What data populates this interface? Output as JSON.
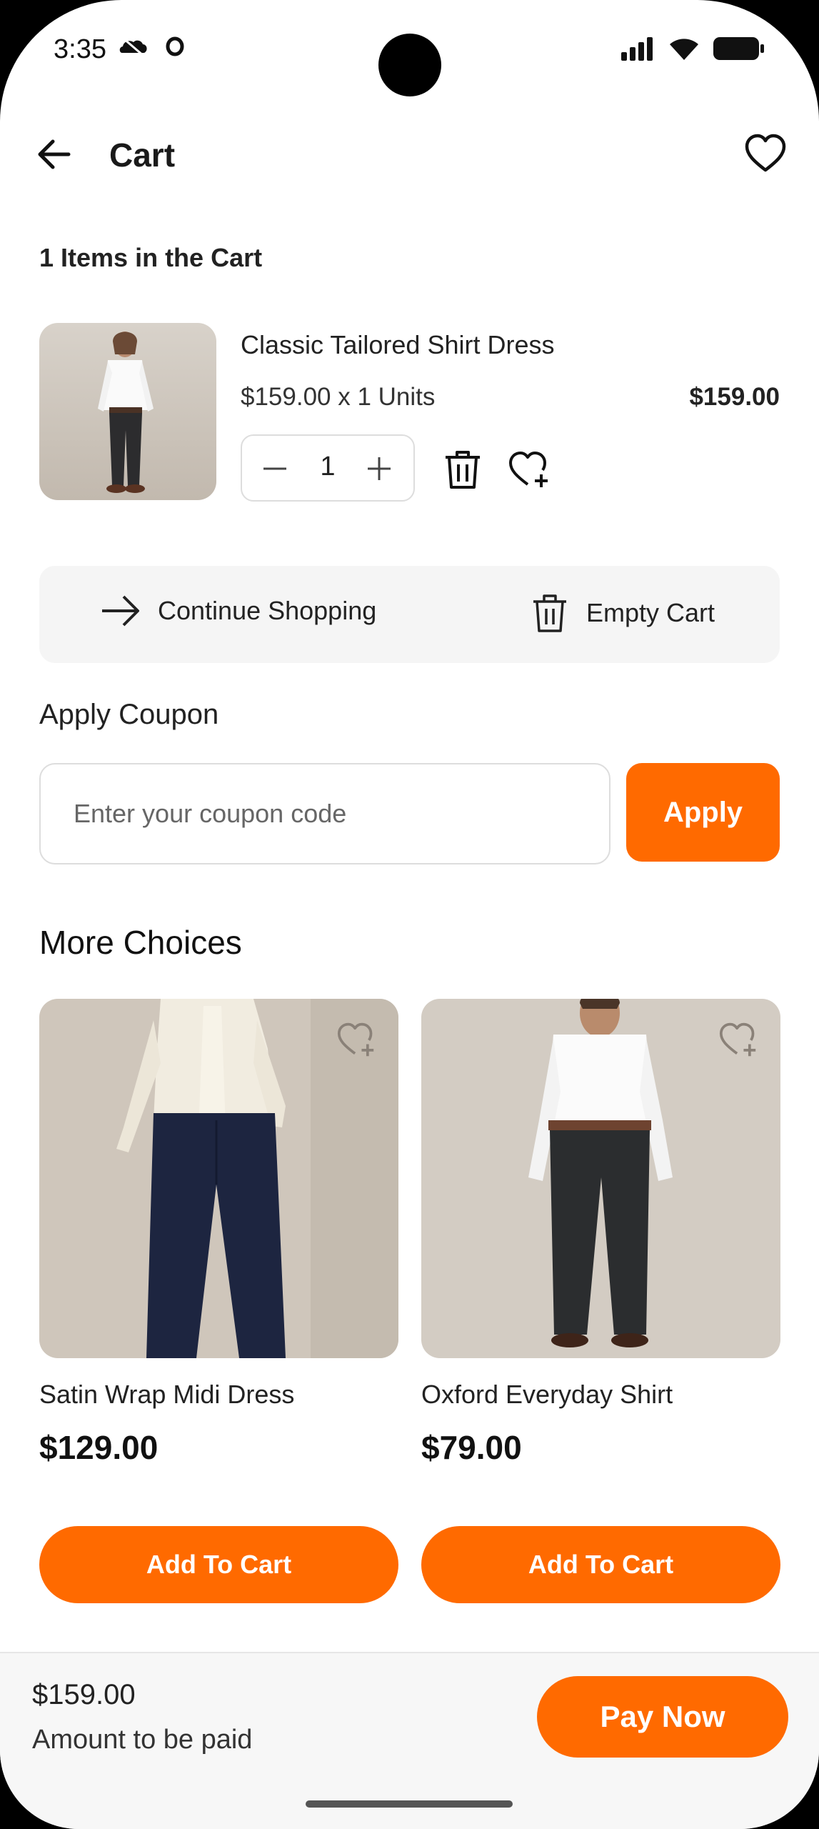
{
  "status_bar": {
    "time": "3:35"
  },
  "header": {
    "title": "Cart"
  },
  "cart": {
    "count_label": "1 Items in the Cart",
    "items": [
      {
        "name": "Classic Tailored Shirt Dress",
        "unit_line": "$159.00 x 1 Units",
        "line_total": "$159.00",
        "quantity": "1"
      }
    ]
  },
  "actions": {
    "continue_label": "Continue Shopping",
    "empty_label": "Empty Cart"
  },
  "coupon": {
    "title": "Apply Coupon",
    "placeholder": "Enter your coupon code",
    "apply_label": "Apply"
  },
  "more_choices": {
    "title": "More Choices",
    "products": [
      {
        "name": "Satin Wrap Midi Dress",
        "price": "$129.00",
        "button": "Add To Cart"
      },
      {
        "name": "Oxford Everyday Shirt",
        "price": "$79.00",
        "button": "Add To Cart"
      }
    ]
  },
  "footer": {
    "amount": "$159.00",
    "amount_label": "Amount to be paid",
    "pay_label": "Pay Now"
  },
  "colors": {
    "accent": "#ff6a00",
    "panel": "#f5f5f5"
  }
}
